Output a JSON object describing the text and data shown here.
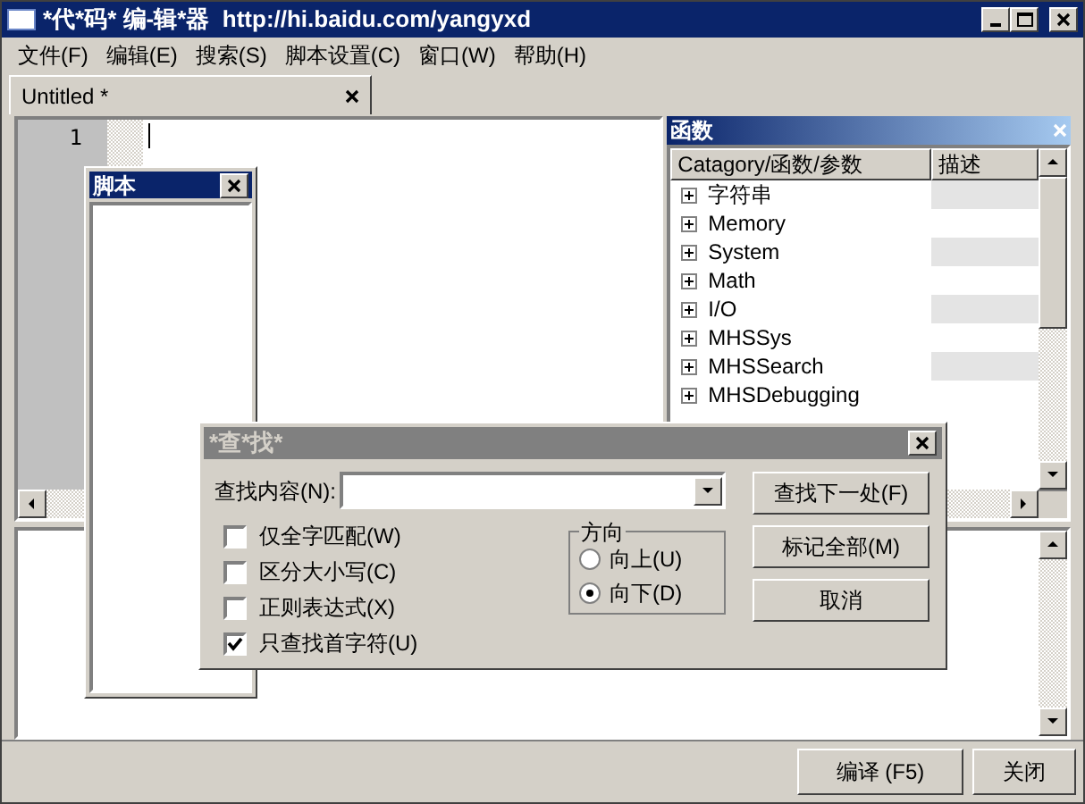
{
  "window": {
    "title": "*代*码* 编-辑*器  http://hi.baidu.com/yangyxd"
  },
  "menu": [
    "文件(F)",
    "编辑(E)",
    "搜索(S)",
    "脚本设置(C)",
    "窗口(W)",
    "帮助(H)"
  ],
  "tabs": [
    {
      "label": "Untitled *",
      "selected": true
    }
  ],
  "editor": {
    "line_numbers": [
      "1"
    ]
  },
  "functions_panel": {
    "title": "函数",
    "columns": [
      "Catagory/函数/参数",
      "描述"
    ],
    "rows": [
      {
        "label": "字符串",
        "expanded": false
      },
      {
        "label": "Memory",
        "expanded": false
      },
      {
        "label": "System",
        "expanded": false
      },
      {
        "label": "Math",
        "expanded": false
      },
      {
        "label": "I/O",
        "expanded": false
      },
      {
        "label": "MHSSys",
        "expanded": false
      },
      {
        "label": "MHSSearch",
        "expanded": false
      },
      {
        "label": "MHSDebugging",
        "expanded": false
      }
    ]
  },
  "script_panel": {
    "title": "脚本"
  },
  "find_dialog": {
    "title": "*查*找*",
    "search_label": "查找内容(N):",
    "options": [
      {
        "label": "仅全字匹配(W)",
        "checked": false
      },
      {
        "label": "区分大小写(C)",
        "checked": false
      },
      {
        "label": "正则表达式(X)",
        "checked": false
      },
      {
        "label": "只查找首字符(U)",
        "checked": true
      }
    ],
    "direction": {
      "title": "方向",
      "options": [
        {
          "label": "向上(U)",
          "selected": false
        },
        {
          "label": "向下(D)",
          "selected": true
        }
      ]
    },
    "buttons": [
      "查找下一处(F)",
      "标记全部(M)",
      "取消"
    ]
  },
  "footer_buttons": [
    "编译 (F5)",
    "关闭"
  ]
}
